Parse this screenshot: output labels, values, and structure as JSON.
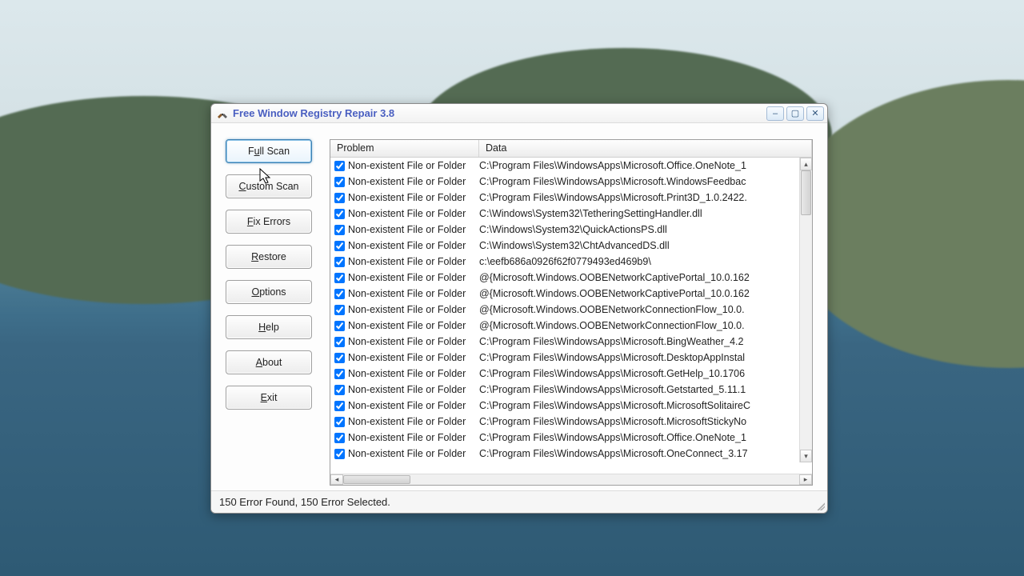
{
  "window": {
    "title": "Free Window Registry Repair 3.8",
    "controls": {
      "minimize": "–",
      "maximize": "▢",
      "close": "✕"
    }
  },
  "sidebar": {
    "full_scan": "Full Scan",
    "custom_scan": "Custom Scan",
    "fix_errors": "Fix Errors",
    "restore": "Restore",
    "options": "Options",
    "help": "Help",
    "about": "About",
    "exit": "Exit"
  },
  "columns": {
    "problem": "Problem",
    "data": "Data"
  },
  "problem_label": "Non-existent File or Folder",
  "rows": [
    {
      "data": "C:\\Program Files\\WindowsApps\\Microsoft.Office.OneNote_1"
    },
    {
      "data": "C:\\Program Files\\WindowsApps\\Microsoft.WindowsFeedbac"
    },
    {
      "data": "C:\\Program Files\\WindowsApps\\Microsoft.Print3D_1.0.2422."
    },
    {
      "data": "C:\\Windows\\System32\\TetheringSettingHandler.dll"
    },
    {
      "data": "C:\\Windows\\System32\\QuickActionsPS.dll"
    },
    {
      "data": "C:\\Windows\\System32\\ChtAdvancedDS.dll"
    },
    {
      "data": "c:\\eefb686a0926f62f0779493ed469b9\\"
    },
    {
      "data": "@{Microsoft.Windows.OOBENetworkCaptivePortal_10.0.162"
    },
    {
      "data": "@{Microsoft.Windows.OOBENetworkCaptivePortal_10.0.162"
    },
    {
      "data": "@{Microsoft.Windows.OOBENetworkConnectionFlow_10.0."
    },
    {
      "data": "@{Microsoft.Windows.OOBENetworkConnectionFlow_10.0."
    },
    {
      "data": "C:\\Program Files\\WindowsApps\\Microsoft.BingWeather_4.2"
    },
    {
      "data": "C:\\Program Files\\WindowsApps\\Microsoft.DesktopAppInstal"
    },
    {
      "data": "C:\\Program Files\\WindowsApps\\Microsoft.GetHelp_10.1706"
    },
    {
      "data": "C:\\Program Files\\WindowsApps\\Microsoft.Getstarted_5.11.1"
    },
    {
      "data": "C:\\Program Files\\WindowsApps\\Microsoft.MicrosoftSolitaireC"
    },
    {
      "data": "C:\\Program Files\\WindowsApps\\Microsoft.MicrosoftStickyNo"
    },
    {
      "data": "C:\\Program Files\\WindowsApps\\Microsoft.Office.OneNote_1"
    },
    {
      "data": "C:\\Program Files\\WindowsApps\\Microsoft.OneConnect_3.17"
    }
  ],
  "status": "150 Error Found,  150 Error Selected."
}
